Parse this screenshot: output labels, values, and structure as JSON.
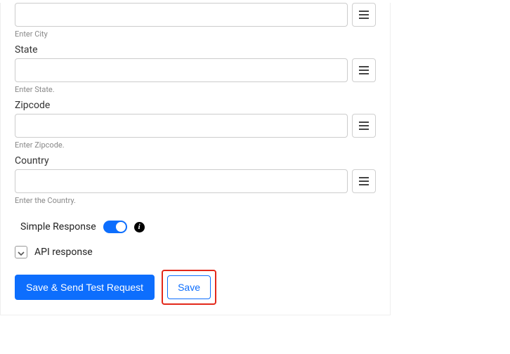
{
  "fields": {
    "city": {
      "label": "",
      "helper": "Enter City",
      "value": ""
    },
    "state": {
      "label": "State",
      "helper": "Enter State.",
      "value": ""
    },
    "zipcode": {
      "label": "Zipcode",
      "helper": "Enter Zipcode.",
      "value": ""
    },
    "country": {
      "label": "Country",
      "helper": "Enter the Country.",
      "value": ""
    }
  },
  "simpleResponse": {
    "label": "Simple Response",
    "enabled": true
  },
  "apiResponse": {
    "label": "API response",
    "expanded": false
  },
  "buttons": {
    "saveSend": "Save & Send Test Request",
    "save": "Save"
  },
  "infoGlyph": "i"
}
